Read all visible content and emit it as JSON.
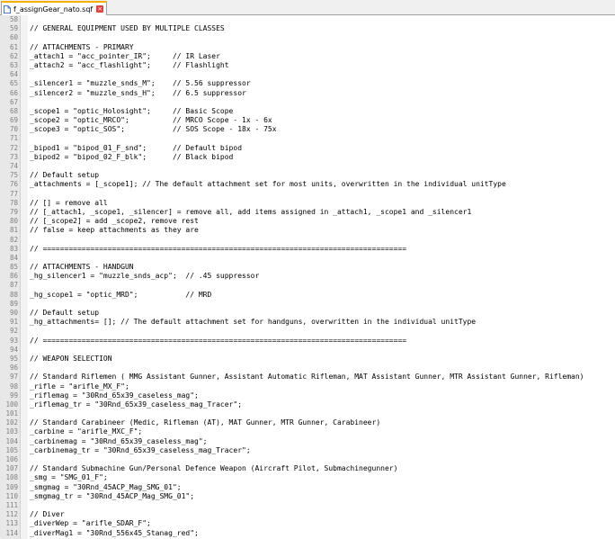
{
  "tab": {
    "filename": "f_assignGear_nato.sqf",
    "close": "×"
  },
  "lines": [
    {
      "n": "58",
      "t": ""
    },
    {
      "n": "59",
      "t": "// GENERAL EQUIPMENT USED BY MULTIPLE CLASSES"
    },
    {
      "n": "60",
      "t": ""
    },
    {
      "n": "61",
      "t": "// ATTACHMENTS - PRIMARY"
    },
    {
      "n": "62",
      "t": "_attach1 = \"acc_pointer_IR\";     // IR Laser"
    },
    {
      "n": "63",
      "t": "_attach2 = \"acc_flashlight\";     // Flashlight"
    },
    {
      "n": "64",
      "t": ""
    },
    {
      "n": "65",
      "t": "_silencer1 = \"muzzle_snds_M\";    // 5.56 suppressor"
    },
    {
      "n": "66",
      "t": "_silencer2 = \"muzzle_snds_H\";    // 6.5 suppressor"
    },
    {
      "n": "67",
      "t": ""
    },
    {
      "n": "68",
      "t": "_scope1 = \"optic_Holosight\";     // Basic Scope"
    },
    {
      "n": "69",
      "t": "_scope2 = \"optic_MRCO\";          // MRCO Scope - 1x - 6x"
    },
    {
      "n": "70",
      "t": "_scope3 = \"optic_SOS\";           // SOS Scope - 18x - 75x"
    },
    {
      "n": "71",
      "t": ""
    },
    {
      "n": "72",
      "t": "_bipod1 = \"bipod_01_F_snd\";      // Default bipod"
    },
    {
      "n": "73",
      "t": "_bipod2 = \"bipod_02_F_blk\";      // Black bipod"
    },
    {
      "n": "74",
      "t": ""
    },
    {
      "n": "75",
      "t": "// Default setup"
    },
    {
      "n": "76",
      "t": "_attachments = [_scope1]; // The default attachment set for most units, overwritten in the individual unitType"
    },
    {
      "n": "77",
      "t": ""
    },
    {
      "n": "78",
      "t": "// [] = remove all"
    },
    {
      "n": "79",
      "t": "// [_attach1, _scope1, _silencer] = remove all, add items assigned in _attach1, _scope1 and _silencer1"
    },
    {
      "n": "80",
      "t": "// [_scope2] = add _scope2, remove rest"
    },
    {
      "n": "81",
      "t": "// false = keep attachments as they are"
    },
    {
      "n": "82",
      "t": ""
    },
    {
      "n": "83",
      "t": "// ===================================================================================="
    },
    {
      "n": "84",
      "t": ""
    },
    {
      "n": "85",
      "t": "// ATTACHMENTS - HANDGUN"
    },
    {
      "n": "86",
      "t": "_hg_silencer1 = \"muzzle_snds_acp\";  // .45 suppressor"
    },
    {
      "n": "87",
      "t": ""
    },
    {
      "n": "88",
      "t": "_hg_scope1 = \"optic_MRD\";           // MRD"
    },
    {
      "n": "89",
      "t": ""
    },
    {
      "n": "90",
      "t": "// Default setup"
    },
    {
      "n": "91",
      "t": "_hg_attachments= []; // The default attachment set for handguns, overwritten in the individual unitType"
    },
    {
      "n": "92",
      "t": ""
    },
    {
      "n": "93",
      "t": "// ===================================================================================="
    },
    {
      "n": "94",
      "t": ""
    },
    {
      "n": "95",
      "t": "// WEAPON SELECTION"
    },
    {
      "n": "96",
      "t": ""
    },
    {
      "n": "97",
      "t": "// Standard Riflemen ( MMG Assistant Gunner, Assistant Automatic Rifleman, MAT Assistant Gunner, MTR Assistant Gunner, Rifleman)"
    },
    {
      "n": "98",
      "t": "_rifle = \"arifle_MX_F\";"
    },
    {
      "n": "99",
      "t": "_riflemag = \"30Rnd_65x39_caseless_mag\";"
    },
    {
      "n": "100",
      "t": "_riflemag_tr = \"30Rnd_65x39_caseless_mag_Tracer\";"
    },
    {
      "n": "101",
      "t": ""
    },
    {
      "n": "102",
      "t": "// Standard Carabineer (Medic, Rifleman (AT), MAT Gunner, MTR Gunner, Carabineer)"
    },
    {
      "n": "103",
      "t": "_carbine = \"arifle_MXC_F\";"
    },
    {
      "n": "104",
      "t": "_carbinemag = \"30Rnd_65x39_caseless_mag\";"
    },
    {
      "n": "105",
      "t": "_carbinemag_tr = \"30Rnd_65x39_caseless_mag_Tracer\";"
    },
    {
      "n": "106",
      "t": ""
    },
    {
      "n": "107",
      "t": "// Standard Submachine Gun/Personal Defence Weapon (Aircraft Pilot, Submachinegunner)"
    },
    {
      "n": "108",
      "t": "_smg = \"SMG_01_F\";"
    },
    {
      "n": "109",
      "t": "_smgmag = \"30Rnd_45ACP_Mag_SMG_01\";"
    },
    {
      "n": "110",
      "t": "_smgmag_tr = \"30Rnd_45ACP_Mag_SMG_01\";"
    },
    {
      "n": "111",
      "t": ""
    },
    {
      "n": "112",
      "t": "// Diver"
    },
    {
      "n": "113",
      "t": "_diverWep = \"arifle_SDAR_F\";"
    },
    {
      "n": "114",
      "t": "_diverMag1 = \"30Rnd_556x45_Stanag_red\";"
    }
  ]
}
